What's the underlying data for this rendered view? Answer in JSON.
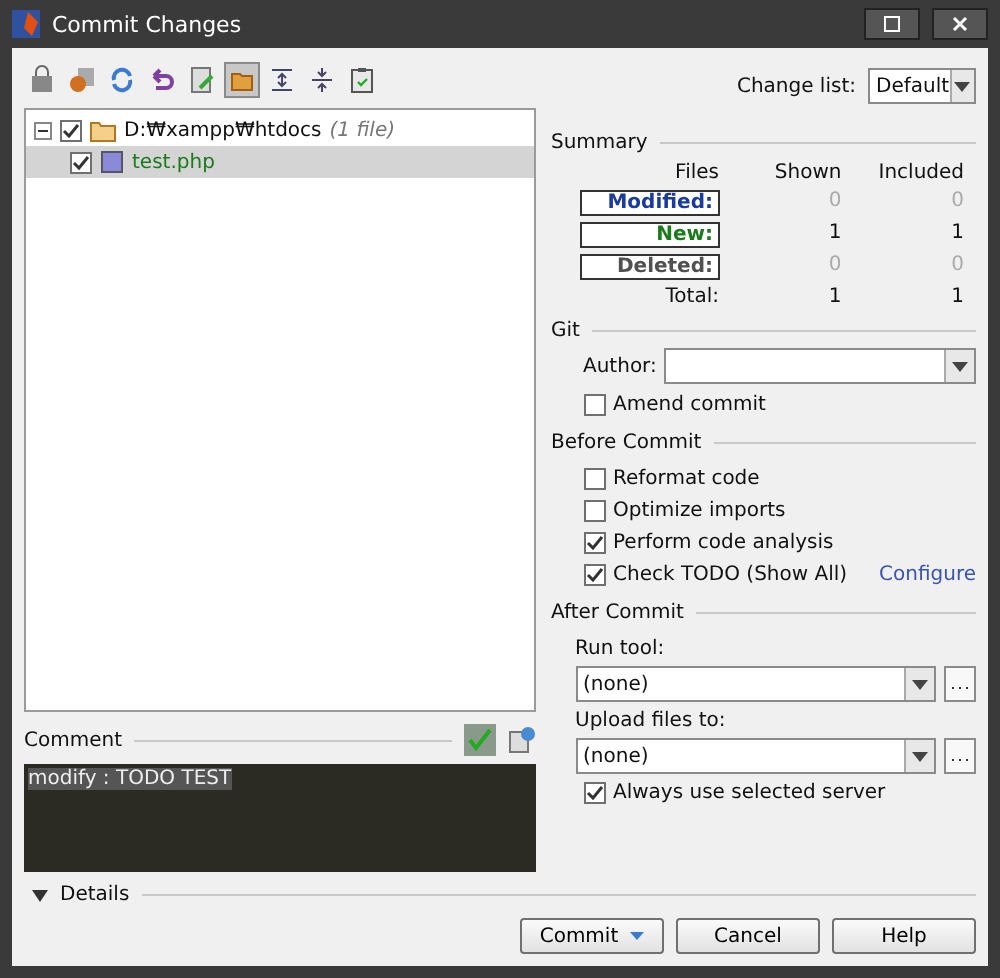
{
  "window": {
    "title": "Commit Changes"
  },
  "toolbar": [
    {
      "selected": false
    },
    {
      "selected": false
    },
    {
      "selected": false
    },
    {
      "selected": false
    },
    {
      "selected": false
    },
    {
      "selected": true
    },
    {
      "selected": false
    },
    {
      "selected": false
    },
    {
      "selected": false
    }
  ],
  "change_list": {
    "label": "Change list:",
    "value": "Default"
  },
  "tree": [
    {
      "label": "D:₩xampp₩htdocs",
      "note": "(1 file)",
      "checked": true,
      "expanded": true,
      "children": [
        {
          "label": "test.php",
          "checked": true,
          "selected": true
        }
      ]
    }
  ],
  "comment": {
    "label": "Comment",
    "value": "modify : TODO TEST"
  },
  "details": {
    "label": "Details",
    "expanded": false
  },
  "summary": {
    "title": "Summary",
    "columns": [
      "Files",
      "Shown",
      "Included"
    ],
    "rows": [
      {
        "label": "Modified:",
        "color": "#1a3a9c",
        "shown": "0",
        "included": "0",
        "disabled": true
      },
      {
        "label": "New:",
        "color": "#1c7a1c",
        "shown": "1",
        "included": "1",
        "disabled": false
      },
      {
        "label": "Deleted:",
        "color": "#505050",
        "shown": "0",
        "included": "0",
        "disabled": true
      }
    ],
    "total": {
      "label": "Total:",
      "shown": "1",
      "included": "1"
    }
  },
  "git": {
    "title": "Git",
    "author_label": "Author:",
    "amend": {
      "label": "Amend commit",
      "checked": false
    }
  },
  "before_commit": {
    "title": "Before Commit",
    "options": [
      {
        "label": "Reformat code",
        "checked": false
      },
      {
        "label": "Optimize imports",
        "checked": false
      },
      {
        "label": "Perform code analysis",
        "checked": true
      },
      {
        "label": "Check TODO (Show All)",
        "checked": true,
        "link": "Configure"
      }
    ]
  },
  "after_commit": {
    "title": "After Commit",
    "run_tool": {
      "label": "Run tool:",
      "value": "(none)"
    },
    "upload": {
      "label": "Upload files to:",
      "value": "(none)"
    },
    "always": {
      "label": "Always use selected server",
      "checked": true
    }
  },
  "buttons": [
    {
      "label": "Commit",
      "kind": "split"
    },
    {
      "label": "Cancel",
      "kind": "plain"
    },
    {
      "label": "Help",
      "kind": "plain"
    }
  ]
}
